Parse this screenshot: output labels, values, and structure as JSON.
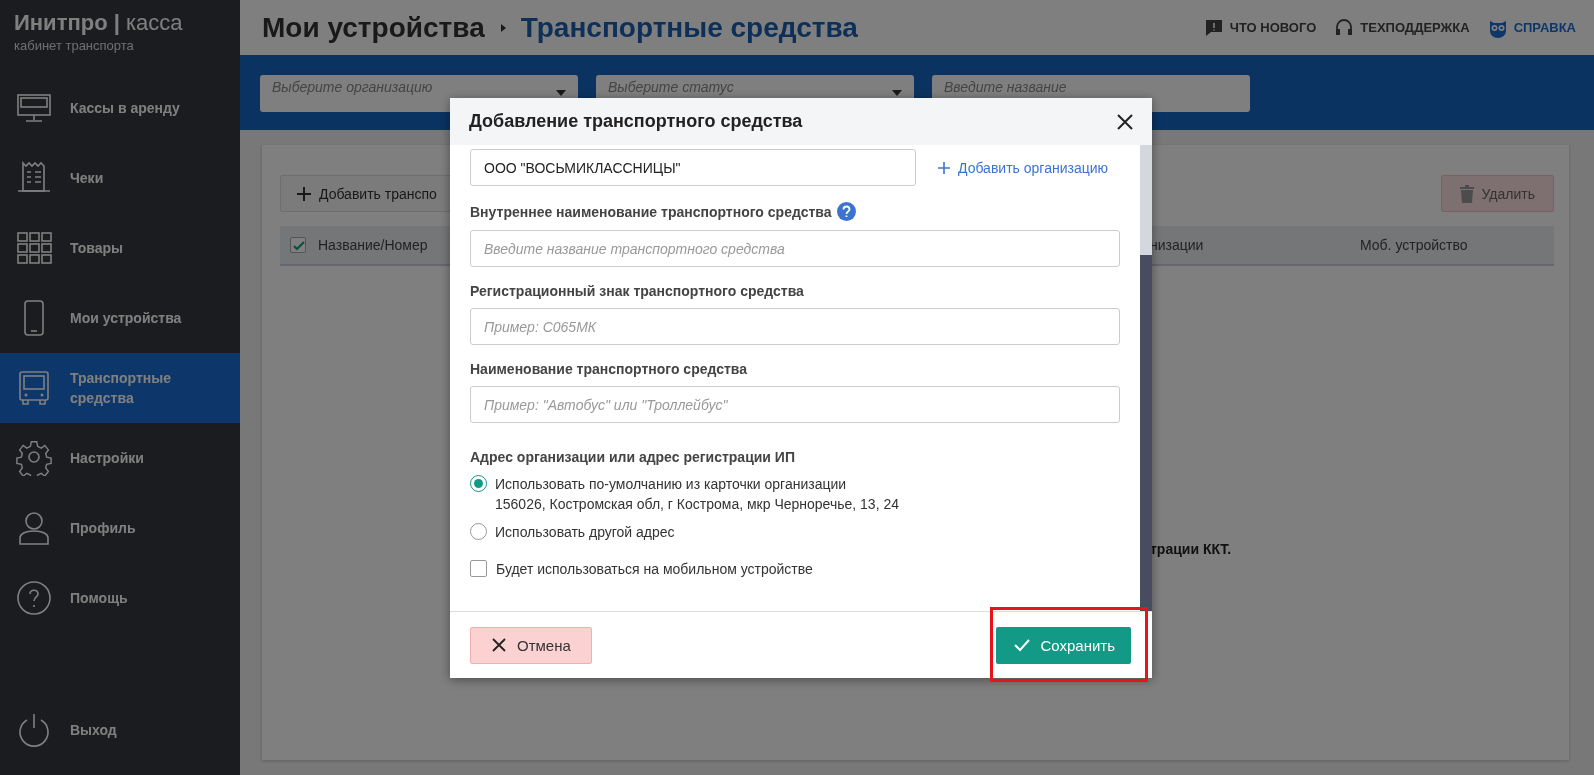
{
  "sidebar": {
    "brand": "**Инитпро |** касса",
    "subtitle": "кабинет транспорта",
    "items": [
      {
        "label": "Кассы в аренду",
        "selected": false
      },
      {
        "label": "Чеки",
        "selected": false
      },
      {
        "label": "Товары",
        "selected": false
      },
      {
        "label": "Мои устройства",
        "selected": false
      },
      {
        "label": "Транспортные средства",
        "selected": true
      },
      {
        "label": "Настройки",
        "selected": false
      },
      {
        "label": "Профиль",
        "selected": false
      },
      {
        "label": "Помощь",
        "selected": false
      }
    ],
    "footer_item": {
      "label": "Выход"
    }
  },
  "header": {
    "breadcrumb": [
      "Мои устройства",
      "Транспортные средства"
    ],
    "links": [
      {
        "label": "ЧТО НОВОГО",
        "highlighted": false
      },
      {
        "label": "ТЕХПОДДЕРЖКА",
        "highlighted": false
      },
      {
        "label": "СПРАВКА",
        "highlighted": true
      }
    ]
  },
  "filters": [
    {
      "placeholder": "Выберите организацию",
      "kind": "select"
    },
    {
      "placeholder": "Выберите статус",
      "kind": "select"
    },
    {
      "placeholder": "Введите название",
      "kind": "text"
    }
  ],
  "toolbar": {
    "add_button": "Добавить транспо",
    "delete_button": {
      "label": "Удалить",
      "disabled": true
    }
  },
  "table": {
    "select_all_checked": true,
    "columns": [
      "Название/Номер",
      "низации",
      "Моб. устройство"
    ]
  },
  "notice": "трации ККТ.",
  "dialog": {
    "title": "Добавление транспортного средства",
    "organization": {
      "value": "ООО \"ВОСЬМИКЛАССНИЦЫ\"",
      "add_link": "Добавить организацию"
    },
    "fields": [
      {
        "label": "Внутреннее наименование транспортного средства",
        "placeholder": "Введите название транспортного средства",
        "help": true
      },
      {
        "label": "Регистрационный знак транспортного средства",
        "placeholder": "Пример: С065МК",
        "help": false
      },
      {
        "label": "Наименование транспортного средства",
        "placeholder": "Пример: \"Автобус\" или \"Троллейбус\"",
        "help": false
      }
    ],
    "address": {
      "label": "Адрес организации или адрес регистрации ИП",
      "options": [
        {
          "label": "Использовать по-умолчанию из карточки организации",
          "detail": "156026, Костромская обл, г Кострома, мкр Черноречье, 13, 24",
          "selected": true
        },
        {
          "label": "Использовать другой адрес",
          "selected": false
        }
      ]
    },
    "mobile": {
      "label": "Будет использоваться на мобильном устройстве",
      "checked": false
    },
    "cancel_button": "Отмена",
    "save_button": {
      "label": "Сохранить",
      "highlighted": true
    }
  }
}
